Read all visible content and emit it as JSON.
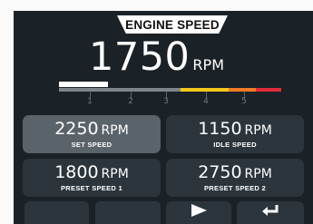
{
  "title": "ENGINE SPEED",
  "current": {
    "value": "1750",
    "unit": "RPM"
  },
  "gauge": {
    "level_fraction": 0.22,
    "tick_labels": [
      "1",
      "2",
      "3",
      "4",
      "5"
    ]
  },
  "buttons": [
    {
      "value": "2250",
      "unit": "RPM",
      "label": "SET SPEED",
      "selected": true
    },
    {
      "value": "1150",
      "unit": "RPM",
      "label": "IDLE SPEED",
      "selected": false
    },
    {
      "value": "1800",
      "unit": "RPM",
      "label": "PRESET SPEED 1",
      "selected": false
    },
    {
      "value": "2750",
      "unit": "RPM",
      "label": "PRESET SPEED 2",
      "selected": false
    }
  ],
  "nav": [
    {
      "icon": "blank",
      "label": ""
    },
    {
      "icon": "blank",
      "label": ""
    },
    {
      "icon": "play-icon",
      "label": ""
    },
    {
      "icon": "enter-icon",
      "label": ""
    }
  ],
  "colors": {
    "background": "#1b2227",
    "button": "#2c353c",
    "button_selected": "#5b636a",
    "gauge_yellow": "#f4c91c",
    "gauge_orange": "#ef7b22",
    "gauge_red": "#e02b3c"
  }
}
